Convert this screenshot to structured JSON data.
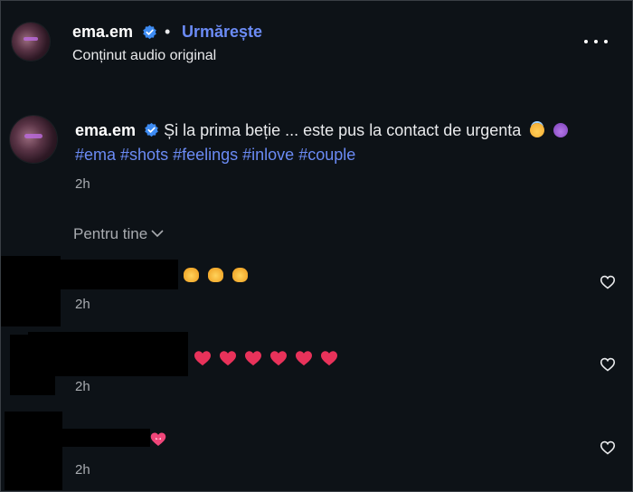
{
  "header": {
    "username": "ema.em",
    "separator": "•",
    "follow_label": "Urmărește",
    "audio_label": "Conținut audio original"
  },
  "caption": {
    "username": "ema.em",
    "text": " Și la prima beție ... este pus la contact de urgenta",
    "hashtags": [
      "#ema",
      "#shots",
      "#feelings",
      "#inlove",
      "#couple"
    ],
    "time": "2h"
  },
  "filter": {
    "label": "Pentru tine"
  },
  "comments": [
    {
      "time": "2h",
      "emoji": "clap",
      "count": 3
    },
    {
      "time": "2h",
      "emoji": "red-heart",
      "count": 6
    },
    {
      "time": "2h",
      "emoji": "heart-with-ribbon",
      "count": 1
    }
  ],
  "colors": {
    "background": "#0d1217",
    "link": "#6b8bf5",
    "verified": "#3d8bf2",
    "muted": "#a8abb0"
  },
  "icons": [
    "verified-icon",
    "more-options-icon",
    "chevron-down-icon",
    "heart-icon"
  ]
}
